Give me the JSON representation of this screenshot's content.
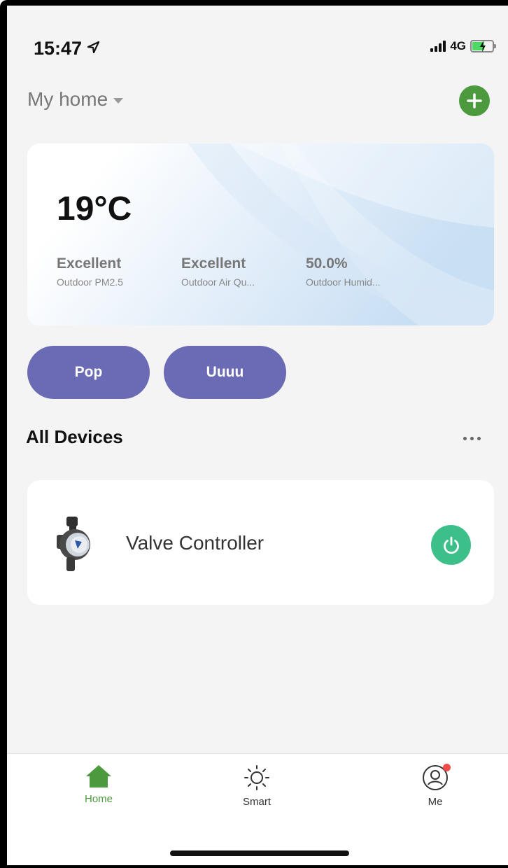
{
  "status_bar": {
    "time": "15:47",
    "network": "4G",
    "icons": [
      "location-arrow-icon",
      "signal-icon",
      "battery-charging-icon"
    ]
  },
  "header": {
    "home_name": "My home",
    "add_icon": "plus-icon"
  },
  "weather": {
    "temperature": "19°C",
    "metrics": [
      {
        "value": "Excellent",
        "label": "Outdoor PM2.5"
      },
      {
        "value": "Excellent",
        "label": "Outdoor Air Qu..."
      },
      {
        "value": "50.0%",
        "label": "Outdoor Humid..."
      }
    ]
  },
  "scenes": [
    {
      "label": "Pop"
    },
    {
      "label": "Uuuu"
    }
  ],
  "devices_section": {
    "title": "All Devices",
    "more_icon": "more-dots-icon"
  },
  "devices": [
    {
      "name": "Valve Controller",
      "icon": "valve-icon",
      "power_icon": "power-icon"
    }
  ],
  "tab_bar": {
    "tabs": [
      {
        "label": "Home",
        "icon": "home-icon",
        "active": true
      },
      {
        "label": "Smart",
        "icon": "sun-icon",
        "active": false
      },
      {
        "label": "Me",
        "icon": "profile-icon",
        "active": false
      }
    ]
  },
  "colors": {
    "accent_green": "#4b9a3d",
    "scene_purple": "#6b6bb5",
    "power_green": "#3dbf8a",
    "badge_red": "#f24a4a",
    "background": "#f4f4f4"
  }
}
